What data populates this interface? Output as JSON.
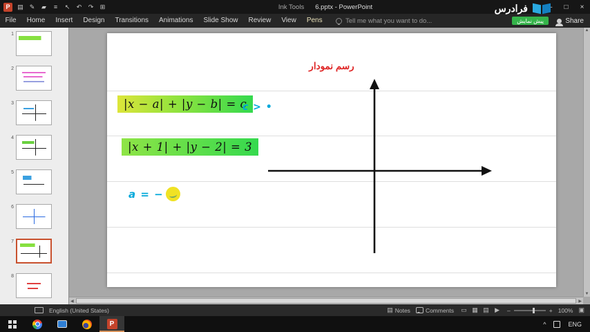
{
  "titlebar": {
    "context_label": "Ink Tools",
    "title": "6.pptx - PowerPoint",
    "quick_access_icons": [
      "save-icon",
      "ink-pen-icon",
      "highlighter-icon",
      "bullet-list-icon",
      "lasso-select-icon",
      "undo-icon",
      "redo-icon",
      "grid-icon"
    ],
    "window_controls": [
      "minimize-icon",
      "maximize-icon",
      "close-icon"
    ]
  },
  "ribbon": {
    "tabs": [
      {
        "label": "File"
      },
      {
        "label": "Home"
      },
      {
        "label": "Insert"
      },
      {
        "label": "Design"
      },
      {
        "label": "Transitions"
      },
      {
        "label": "Animations"
      },
      {
        "label": "Slide Show"
      },
      {
        "label": "Review"
      },
      {
        "label": "View"
      },
      {
        "label": "Pens",
        "contextual": true
      }
    ],
    "tell_me": "Tell me what you want to do...",
    "share": "Share"
  },
  "brand": {
    "name": "فرادرس",
    "badge": "پیش نمایش"
  },
  "thumbnails": [
    {
      "n": "1",
      "kind": "formula-green"
    },
    {
      "n": "2",
      "kind": "text-pink"
    },
    {
      "n": "3",
      "kind": "graph"
    },
    {
      "n": "4",
      "kind": "graph-green"
    },
    {
      "n": "5",
      "kind": "graph-small"
    },
    {
      "n": "6",
      "kind": "graph-blue"
    },
    {
      "n": "7",
      "kind": "formula-axes",
      "selected": true
    },
    {
      "n": "8",
      "kind": "text-red"
    }
  ],
  "slide": {
    "title": "رسم نمودار",
    "formula1": "|x − a| + |y − b| = c",
    "annotation1": "c > •",
    "formula2": "|x + 1| + |y − 2| = 3",
    "annotation2": "a = −"
  },
  "statusbar": {
    "language": "English (United States)",
    "notes_label": "Notes",
    "comments_label": "Comments",
    "view_icons": [
      "normal-view-icon",
      "slide-sorter-icon",
      "reading-view-icon",
      "slideshow-icon"
    ],
    "zoom_level": "100%"
  },
  "taskbar": {
    "apps": [
      {
        "icon": "windows-start-icon"
      },
      {
        "icon": "chrome-icon"
      },
      {
        "icon": "monitor-icon"
      },
      {
        "icon": "firefox-icon"
      },
      {
        "icon": "powerpoint-icon",
        "active": true
      }
    ],
    "tray_caret": "^",
    "language": "ENG"
  },
  "colors": {
    "highlight_yellow_green": "#dde53a",
    "highlight_green": "#35d94e",
    "ink_blue": "#00a8da",
    "title_red": "#df2626",
    "selected_thumb_border": "#c8512e"
  }
}
